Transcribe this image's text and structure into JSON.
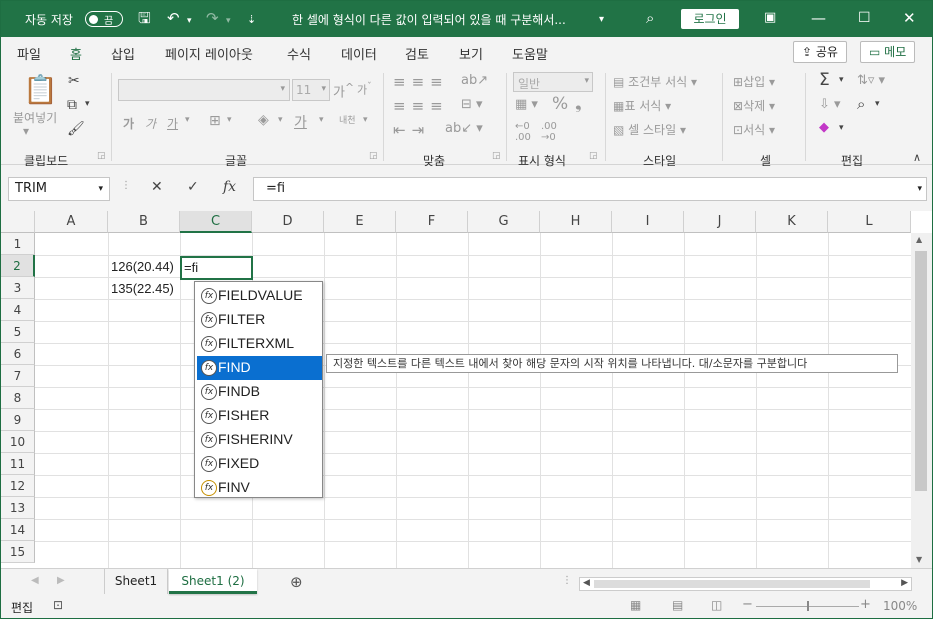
{
  "titlebar": {
    "autosave_label": "자동 저장",
    "autosave_state": "끔",
    "doc_title": "한 셀에 형식이 다른 값이 입력되어 있을 때 구분해서...",
    "login_label": "로그인"
  },
  "tabs": [
    "파일",
    "홈",
    "삽입",
    "페이지 레이아웃",
    "수식",
    "데이터",
    "검토",
    "보기",
    "도움말"
  ],
  "active_tab": "홈",
  "share_label": "공유",
  "memo_label": "메모",
  "ribbon": {
    "clipboard": {
      "paste": "붙여넣기",
      "group": "클립보드"
    },
    "font": {
      "size": "11",
      "group": "글꼴"
    },
    "align": {
      "group": "맞춤"
    },
    "number": {
      "format": "일반",
      "group": "표시 형식"
    },
    "style": {
      "cond": "조건부 서식",
      "table": "표 서식",
      "cell": "셀 스타일",
      "group": "스타일"
    },
    "cells": {
      "insert": "삽입",
      "delete": "삭제",
      "format": "서식",
      "group": "셀"
    },
    "edit": {
      "group": "편집"
    }
  },
  "formula_bar": {
    "name_box": "TRIM",
    "formula": "=fi",
    "fx": "fx"
  },
  "columns": [
    "A",
    "B",
    "C",
    "D",
    "E",
    "F",
    "G",
    "H",
    "I",
    "J",
    "K",
    "L"
  ],
  "rows": [
    "1",
    "2",
    "3",
    "4",
    "5",
    "6",
    "7",
    "8",
    "9",
    "10",
    "11",
    "12",
    "13",
    "14",
    "15"
  ],
  "cells": {
    "B2": "126(20.44)",
    "B3": "135(22.45)",
    "C2": "=fi"
  },
  "autocomplete": [
    "FIELDVALUE",
    "FILTER",
    "FILTERXML",
    "FIND",
    "FINDB",
    "FISHER",
    "FISHERINV",
    "FIXED",
    "FINV"
  ],
  "autocomplete_selected": "FIND",
  "tooltip": "지정한 텍스트를 다른 텍스트 내에서 찾아 해당 문자의 시작 위치를 나타냅니다. 대/소문자를 구분합니다",
  "sheets": [
    "Sheet1",
    "Sheet1 (2)"
  ],
  "active_sheet": "Sheet1 (2)",
  "status": {
    "mode": "편집",
    "zoom": "100%"
  }
}
